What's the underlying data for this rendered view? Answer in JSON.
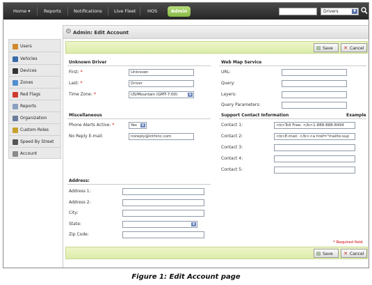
{
  "nav": {
    "items": [
      "Home",
      "Reports",
      "Notifications",
      "Live Fleet",
      "HOS",
      "Admin"
    ],
    "home_caret": "▾",
    "search_value": "",
    "search_scope": "Drivers"
  },
  "sidebar": {
    "items": [
      {
        "label": "Users",
        "icon": "users-icon",
        "color": "#d08a2c"
      },
      {
        "label": "Vehicles",
        "icon": "vehicle-icon",
        "color": "#3b6aa8"
      },
      {
        "label": "Devices",
        "icon": "device-icon",
        "color": "#333333"
      },
      {
        "label": "Zones",
        "icon": "zones-icon",
        "color": "#4f8fd0"
      },
      {
        "label": "Red Flags",
        "icon": "red-flag-icon",
        "color": "#d03a2c"
      },
      {
        "label": "Reports",
        "icon": "reports-icon",
        "color": "#8aa0c0"
      },
      {
        "label": "Organization",
        "icon": "organization-icon",
        "color": "#6a7d9c"
      },
      {
        "label": "Custom Roles",
        "icon": "key-icon",
        "color": "#c9a02c"
      },
      {
        "label": "Speed By Street",
        "icon": "speed-icon",
        "color": "#555555"
      },
      {
        "label": "Account",
        "icon": "account-icon",
        "color": "#8a8a8a"
      }
    ]
  },
  "page": {
    "title": "Admin: Edit Account",
    "save_label": "Save",
    "cancel_label": "Cancel"
  },
  "unknown_driver": {
    "heading": "Unknown Driver",
    "first_label": "First:",
    "first_value": "Unknown",
    "last_label": "Last:",
    "last_value": "Driver",
    "timezone_label": "Time Zone:",
    "timezone_value": "US/Mountain (GMT-7:00)"
  },
  "misc": {
    "heading": "Miscellaneous",
    "phone_alerts_label": "Phone Alerts Active:",
    "phone_alerts_value": "Yes",
    "no_reply_label": "No Reply E-mail:",
    "no_reply_value": "noreply@inthinc.com"
  },
  "address": {
    "heading": "Address:",
    "address1_label": "Address 1:",
    "address1_value": "",
    "address2_label": "Address 2:",
    "address2_value": "",
    "city_label": "City:",
    "city_value": "",
    "state_label": "State:",
    "state_value": "",
    "zip_label": "Zip Code:",
    "zip_value": ""
  },
  "wms": {
    "heading": "Web Map Service",
    "url_label": "URL:",
    "url_value": "",
    "query_label": "Query:",
    "query_value": "",
    "layers_label": "Layers:",
    "layers_value": "",
    "params_label": "Query Parameters:",
    "params_value": ""
  },
  "support": {
    "heading": "Support Contact Information",
    "example_label": "Example",
    "contacts": [
      {
        "label": "Contact 1:",
        "value": "<b>Toll Free: </b>1-888-888-8494"
      },
      {
        "label": "Contact 2:",
        "value": "<b>E-mail: </b><a href=\"mailto:sup"
      },
      {
        "label": "Contact 3:",
        "value": ""
      },
      {
        "label": "Contact 4:",
        "value": ""
      },
      {
        "label": "Contact 5:",
        "value": ""
      }
    ]
  },
  "required_note": "* Required field",
  "required_marker": "*",
  "caption": "Figure 1: Edit Account page",
  "colors": {
    "accent_green": "#9cc85f",
    "action_bar": "#dcecaa",
    "required_red": "#cc0000"
  }
}
